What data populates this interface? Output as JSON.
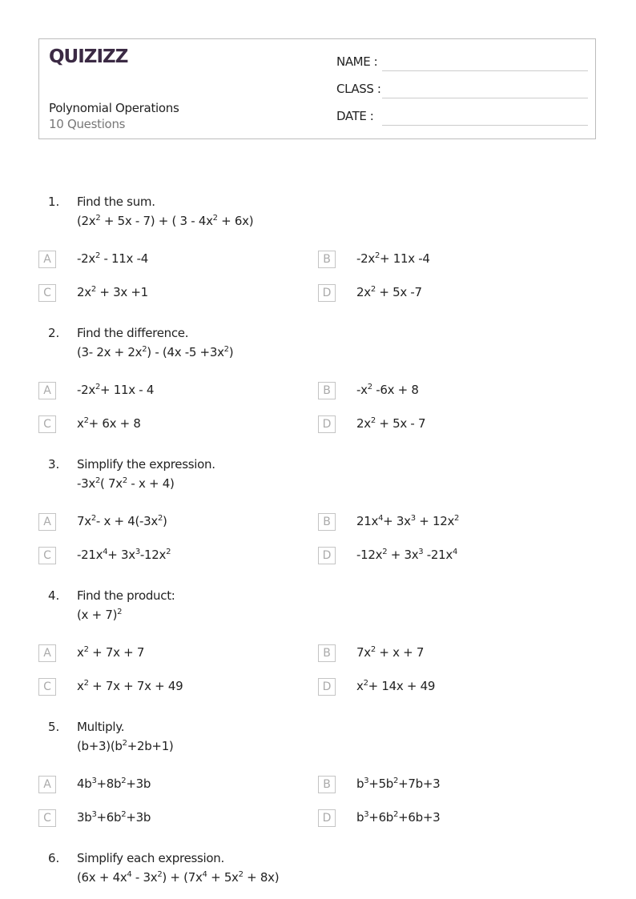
{
  "header": {
    "logo": "QUIZIZZ",
    "title": "Polynomial Operations",
    "subtitle": "10 Questions",
    "fields": [
      {
        "label": "NAME :"
      },
      {
        "label": "CLASS :"
      },
      {
        "label": "DATE  :"
      }
    ]
  },
  "questions": [
    {
      "number": "1.",
      "text": "Find the sum.",
      "expression": "(2x^2 + 5x - 7) + ( 3 - 4x^2 + 6x)",
      "options": [
        {
          "letter": "A",
          "text": "-2x^2 - 11x -4"
        },
        {
          "letter": "B",
          "text": "-2x^2+ 11x -4"
        },
        {
          "letter": "C",
          "text": "2x^2 + 3x +1"
        },
        {
          "letter": "D",
          "text": "2x^2 + 5x -7"
        }
      ]
    },
    {
      "number": "2.",
      "text": "Find the difference.",
      "expression": "(3- 2x + 2x^2) - (4x -5 +3x^2)",
      "options": [
        {
          "letter": "A",
          "text": "-2x^2+ 11x - 4"
        },
        {
          "letter": "B",
          "text": "-x^2 -6x + 8"
        },
        {
          "letter": "C",
          "text": "x^2+ 6x + 8"
        },
        {
          "letter": "D",
          "text": "2x^2 + 5x - 7"
        }
      ]
    },
    {
      "number": "3.",
      "text": "Simplify the expression.",
      "expression": "-3x^2( 7x^2 - x + 4)",
      "options": [
        {
          "letter": "A",
          "text": "7x^2- x + 4(-3x^2)"
        },
        {
          "letter": "B",
          "text": "21x^4+ 3x^3 + 12x^2"
        },
        {
          "letter": "C",
          "text": "-21x^4+ 3x^3-12x^2"
        },
        {
          "letter": "D",
          "text": "-12x^2 + 3x^3 -21x^4"
        }
      ]
    },
    {
      "number": "4.",
      "text": "Find the product:",
      "expression": "(x + 7)^2",
      "options": [
        {
          "letter": "A",
          "text": "x^2 + 7x + 7"
        },
        {
          "letter": "B",
          "text": "7x^2 + x + 7"
        },
        {
          "letter": "C",
          "text": "x^2 + 7x + 7x + 49"
        },
        {
          "letter": "D",
          "text": "x^2+ 14x + 49"
        }
      ]
    },
    {
      "number": "5.",
      "text": "Multiply.",
      "expression": "(b+3)(b^2+2b+1)",
      "options": [
        {
          "letter": "A",
          "text": "4b^3+8b^2+3b"
        },
        {
          "letter": "B",
          "text": "b^3+5b^2+7b+3"
        },
        {
          "letter": "C",
          "text": "3b^3+6b^2+3b"
        },
        {
          "letter": "D",
          "text": "b^3+6b^2+6b+3"
        }
      ]
    },
    {
      "number": "6.",
      "text": "Simplify each expression.",
      "expression": "(6x + 4x^4 - 3x^2) + (7x^4 + 5x^2 + 8x)",
      "options": []
    }
  ]
}
